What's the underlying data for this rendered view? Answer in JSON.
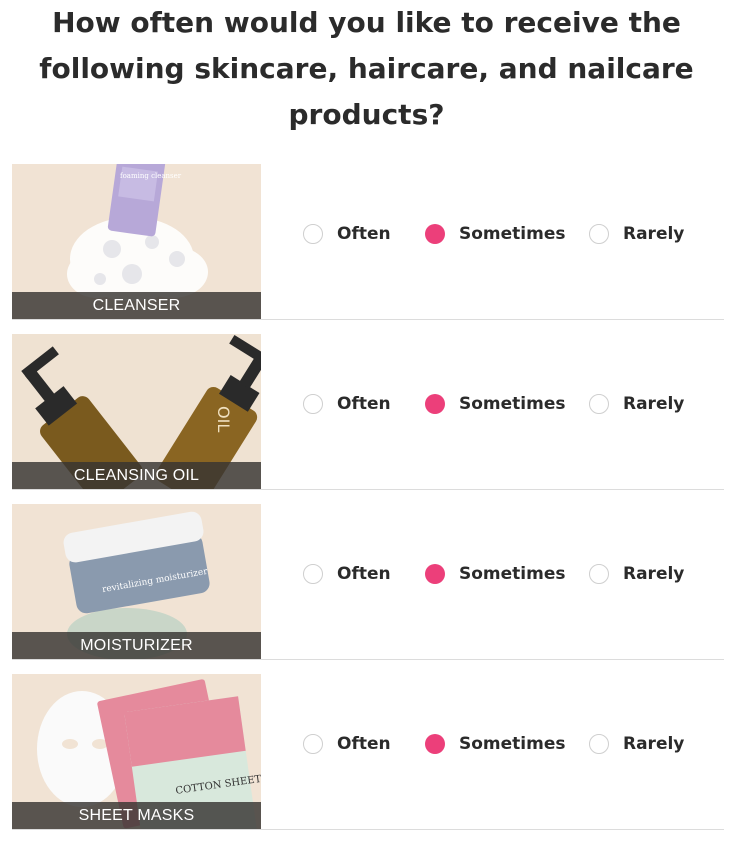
{
  "question": {
    "title": "How often would you like to receive the following skincare, haircare, and nailcare products?"
  },
  "options": [
    "Often",
    "Sometimes",
    "Rarely"
  ],
  "products": [
    {
      "caption": "CLEANSER",
      "image_text": "foaming cleanser",
      "selected": "Sometimes"
    },
    {
      "caption": "CLEANSING OIL",
      "image_text": "OIL",
      "selected": "Sometimes"
    },
    {
      "caption": "MOISTURIZER",
      "image_text": "revitalizing moisturizer",
      "selected": "Sometimes"
    },
    {
      "caption": "SHEET MASKS",
      "image_text": "COTTON SHEET MASK",
      "selected": "Sometimes"
    }
  ],
  "colors": {
    "accent": "#ec3f7a",
    "text": "#2b2b2b",
    "radio_border": "#cfcfcf",
    "thumb_bg": "#f1e3d4",
    "caption_bg": "#373532"
  }
}
